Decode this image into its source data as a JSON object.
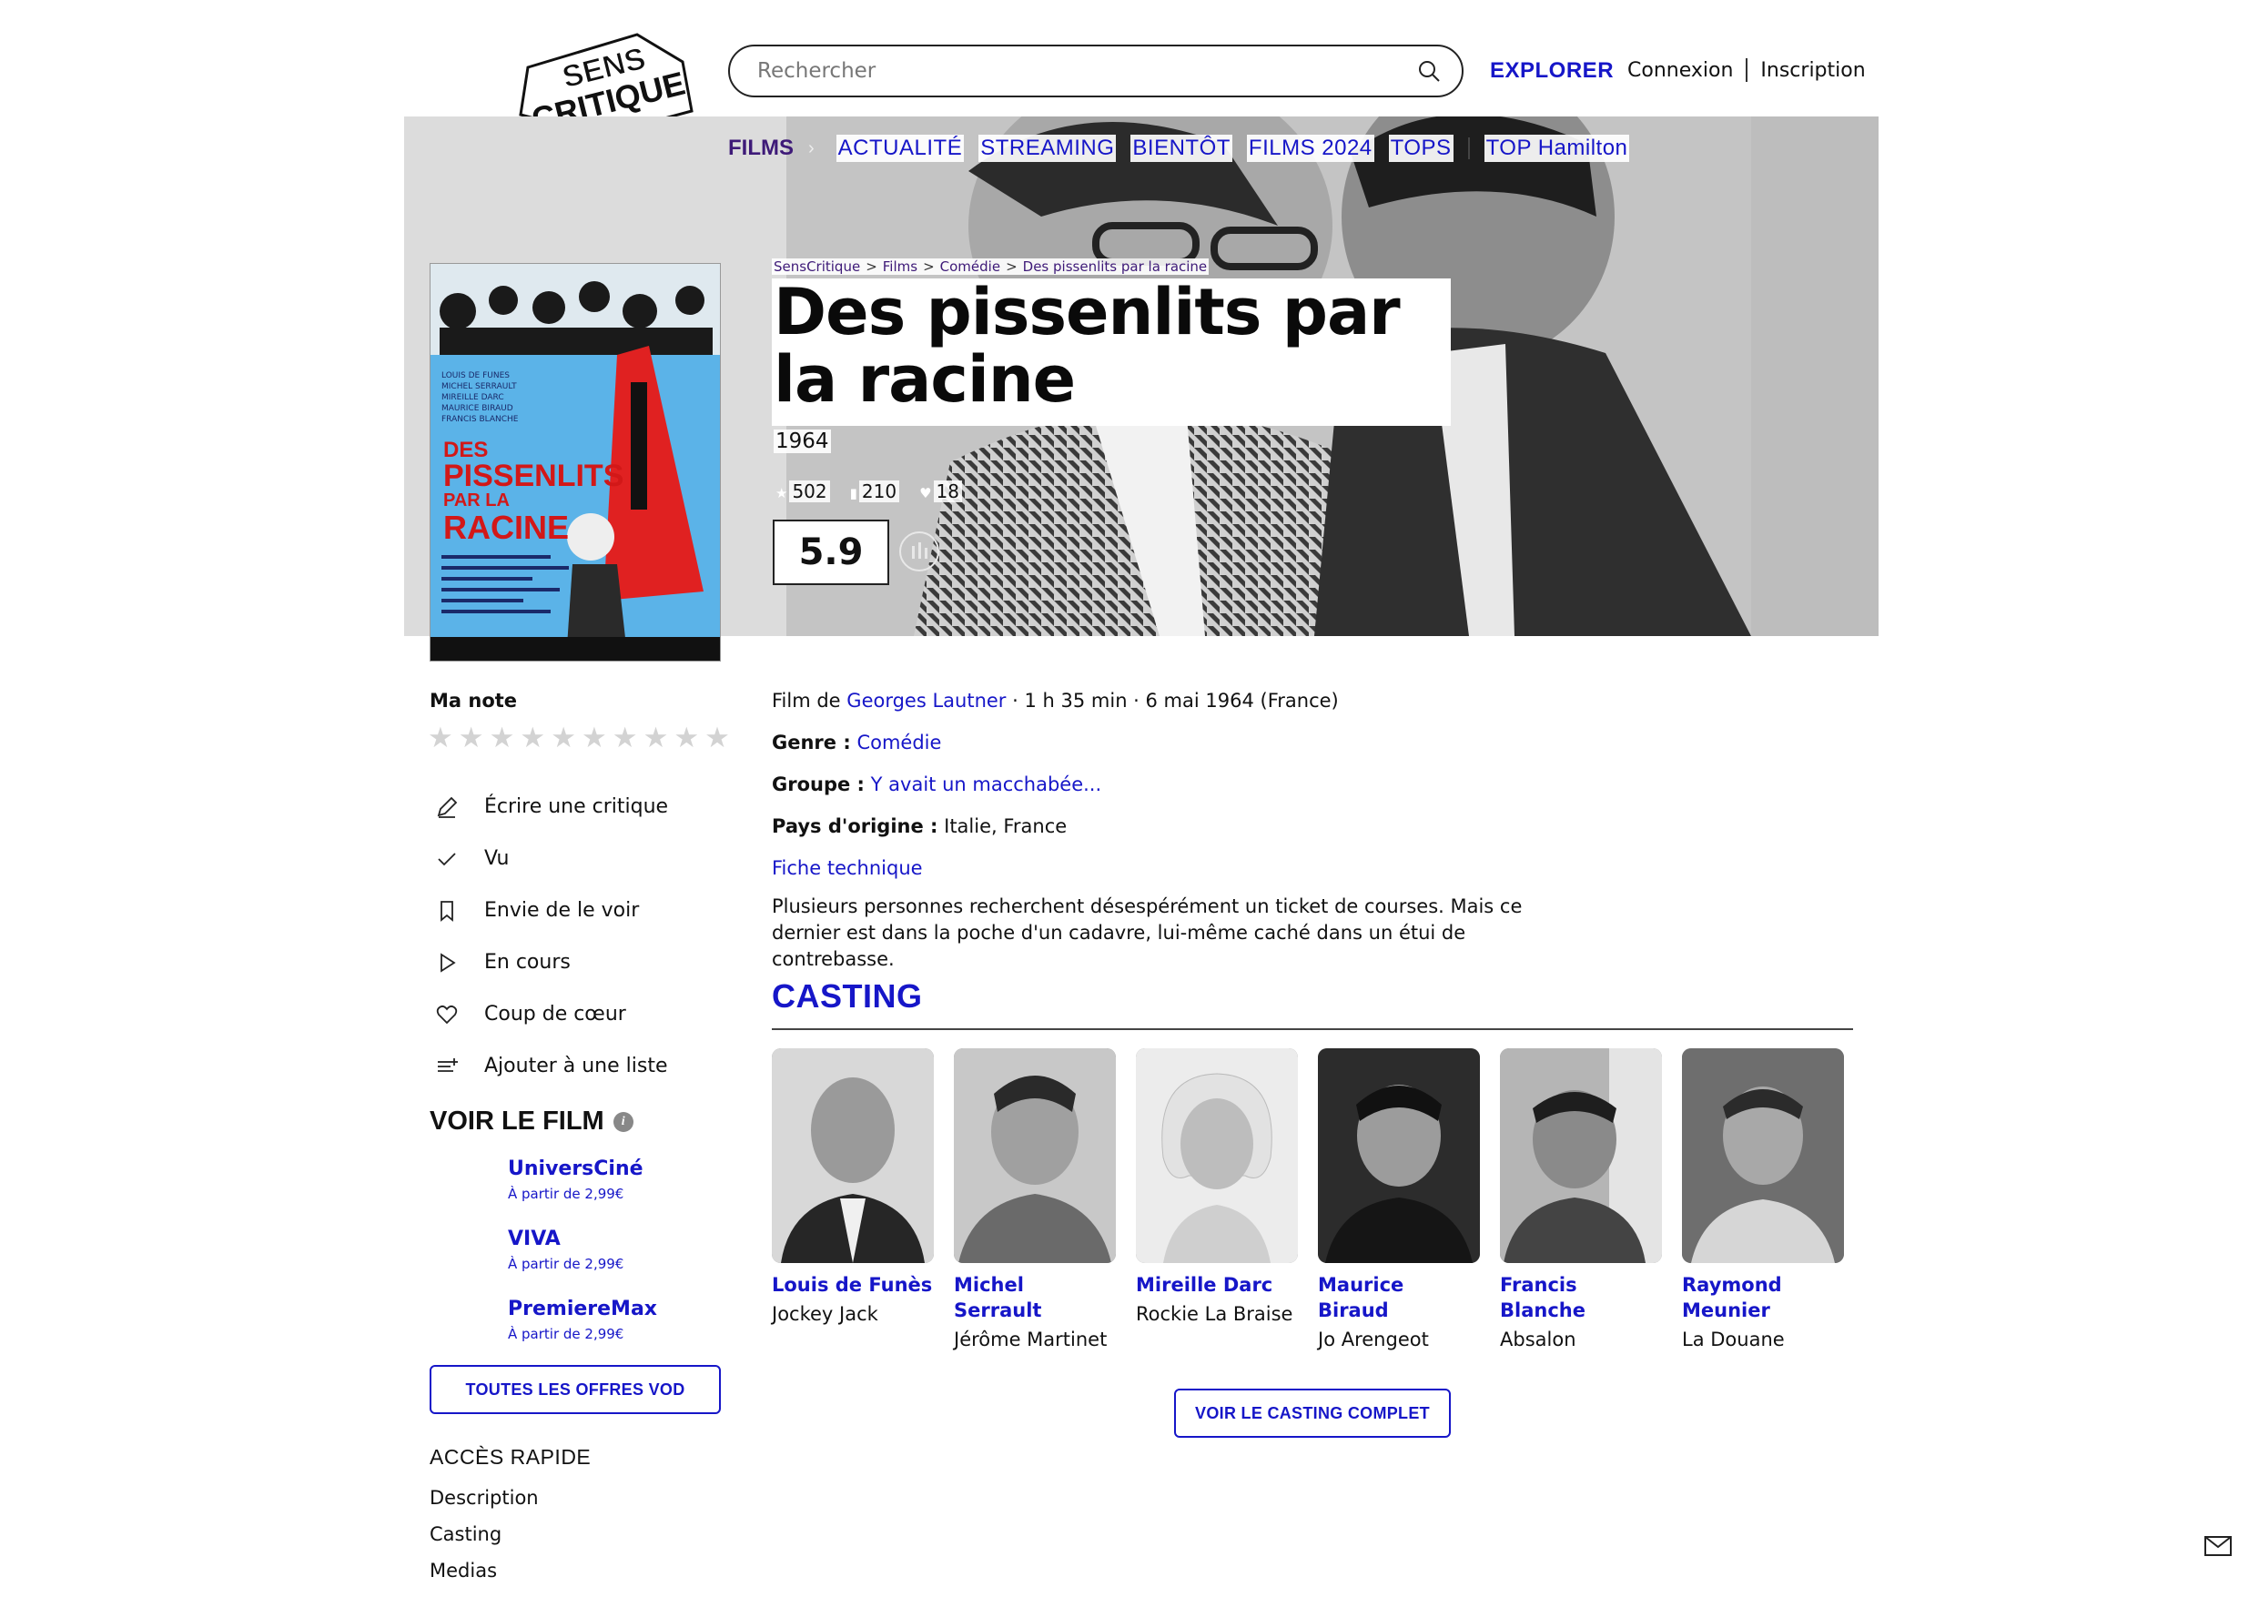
{
  "header": {
    "logo_line1": "SENS",
    "logo_line2": "CRITIQUE",
    "search_placeholder": "Rechercher",
    "explorer": "EXPLORER",
    "login": "Connexion",
    "signup": "Inscription"
  },
  "nav": {
    "active": "FILMS",
    "items": [
      "ACTUALITÉ",
      "STREAMING",
      "BIENTÔT",
      "FILMS 2024",
      "TOPS",
      "TOP Hamilton"
    ]
  },
  "breadcrumb": [
    "SensCritique",
    "Films",
    "Comédie",
    "Des pissenlits par la racine"
  ],
  "film": {
    "title": "Des pissenlits par la racine",
    "year": "1964",
    "stats": [
      "502",
      "210",
      "18"
    ],
    "score": "5.9"
  },
  "poster": {
    "names": "LOUIS DE FUNES\nMICHEL SERRAULT\nMIREILLE DARC\nMAURICE BIRAUD\nFRANCIS BLANCHE",
    "title_lines": [
      "DES",
      "PISSENLITS",
      "PAR LA",
      "RACINE"
    ]
  },
  "sidebar": {
    "ma_note": "Ma note",
    "actions": [
      {
        "icon": "pencil-icon",
        "label": "Écrire une critique"
      },
      {
        "icon": "check-icon",
        "label": "Vu"
      },
      {
        "icon": "bookmark-icon",
        "label": "Envie de le voir"
      },
      {
        "icon": "play-icon",
        "label": "En cours"
      },
      {
        "icon": "heart-icon",
        "label": "Coup de cœur"
      },
      {
        "icon": "list-add-icon",
        "label": "Ajouter à une liste"
      }
    ],
    "voir_le_film": "VOIR LE FILM",
    "vod": [
      {
        "name": "UniversCiné",
        "price": "À partir de 2,99€"
      },
      {
        "name": "VIVA",
        "price": "À partir de 2,99€"
      },
      {
        "name": "PremiereMax",
        "price": "À partir de 2,99€"
      }
    ],
    "vod_button": "TOUTES LES OFFRES VOD",
    "acces_rapide": "ACCÈS RAPIDE",
    "acces_items": [
      "Description",
      "Casting",
      "Medias"
    ]
  },
  "details": {
    "film_de": "Film de",
    "director": "Georges Lautner",
    "meta_rest": " · 1 h 35 min · 6 mai 1964 (France)",
    "genre_label": "Genre :",
    "genre": "Comédie",
    "groupe_label": "Groupe :",
    "groupe": "Y avait un macchabée...",
    "pays_label": "Pays d'origine :",
    "pays": "Italie, France",
    "fiche": "Fiche technique",
    "synopsis": "Plusieurs personnes recherchent désespérément un ticket de courses. Mais ce dernier est dans la poche d'un cadavre, lui-même caché dans un étui de contrebasse."
  },
  "casting": {
    "title": "CASTING",
    "members": [
      {
        "name": "Louis de Funès",
        "role": "Jockey Jack"
      },
      {
        "name": "Michel Serrault",
        "role": "Jérôme Martinet"
      },
      {
        "name": "Mireille Darc",
        "role": "Rockie La Braise"
      },
      {
        "name": "Maurice Biraud",
        "role": "Jo Arengeot"
      },
      {
        "name": "Francis Blanche",
        "role": "Absalon"
      },
      {
        "name": "Raymond Meunier",
        "role": "La Douane"
      }
    ],
    "button": "VOIR LE CASTING COMPLET"
  }
}
